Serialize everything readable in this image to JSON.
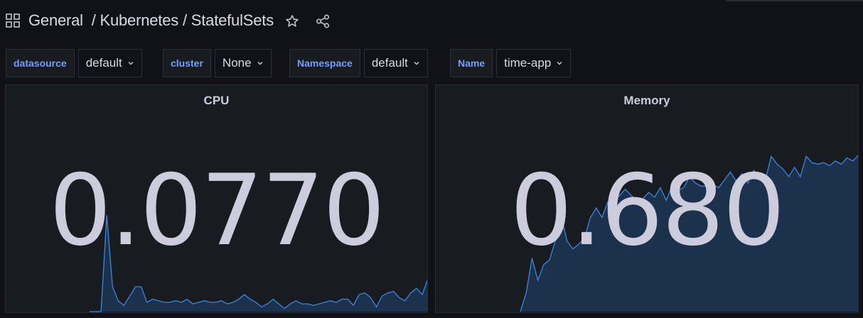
{
  "breadcrumb": {
    "text": "General  / Kubernetes / StatefulSets"
  },
  "icons": {
    "dashboards": "grid-icon",
    "favorite": "star-icon",
    "share": "share-icon",
    "dropdown": "chevron-down-icon"
  },
  "variables": [
    {
      "label": "datasource",
      "value": "default"
    },
    {
      "label": "cluster",
      "value": "None"
    },
    {
      "label": "Namespace",
      "value": "default"
    },
    {
      "label": "Name",
      "value": "time-app"
    }
  ],
  "panels": {
    "cpu": {
      "title": "CPU",
      "value": "0.0770",
      "sparkline": [
        0.0,
        0.0,
        0.0,
        0.62,
        0.16,
        0.07,
        0.04,
        0.1,
        0.16,
        0.16,
        0.06,
        0.08,
        0.07,
        0.06,
        0.06,
        0.07,
        0.06,
        0.08,
        0.05,
        0.06,
        0.07,
        0.06,
        0.06,
        0.07,
        0.05,
        0.06,
        0.08,
        0.11,
        0.08,
        0.06,
        0.03,
        0.05,
        0.08,
        0.05,
        0.02,
        0.05,
        0.07,
        0.05,
        0.05,
        0.04,
        0.05,
        0.06,
        0.07,
        0.06,
        0.08,
        0.08,
        0.04,
        0.11,
        0.12,
        0.09,
        0.03,
        0.1,
        0.12,
        0.13,
        0.09,
        0.07,
        0.12,
        0.15,
        0.11,
        0.21
      ]
    },
    "memory": {
      "title": "Memory",
      "value": "0.680",
      "sparkline": [
        0.0,
        0.12,
        0.34,
        0.2,
        0.3,
        0.33,
        0.45,
        0.61,
        0.45,
        0.4,
        0.43,
        0.47,
        0.6,
        0.66,
        0.6,
        0.7,
        0.7,
        0.74,
        0.78,
        0.74,
        0.71,
        0.72,
        0.76,
        0.73,
        0.79,
        0.71,
        0.8,
        0.77,
        0.79,
        0.86,
        0.82,
        0.8,
        0.8,
        0.81,
        0.79,
        0.84,
        0.89,
        0.83,
        0.88,
        0.82,
        0.9,
        0.86,
        0.84,
        0.99,
        0.94,
        0.91,
        0.86,
        0.92,
        0.86,
        0.99,
        0.95,
        0.94,
        0.95,
        0.93,
        0.96,
        0.94,
        0.98,
        0.96,
        1.0
      ]
    }
  },
  "colors": {
    "accent": "#6e9fff",
    "spark_line": "#3d86e0",
    "spark_fill": "#1d3554",
    "background": "#111217",
    "panel": "#181b1f"
  }
}
